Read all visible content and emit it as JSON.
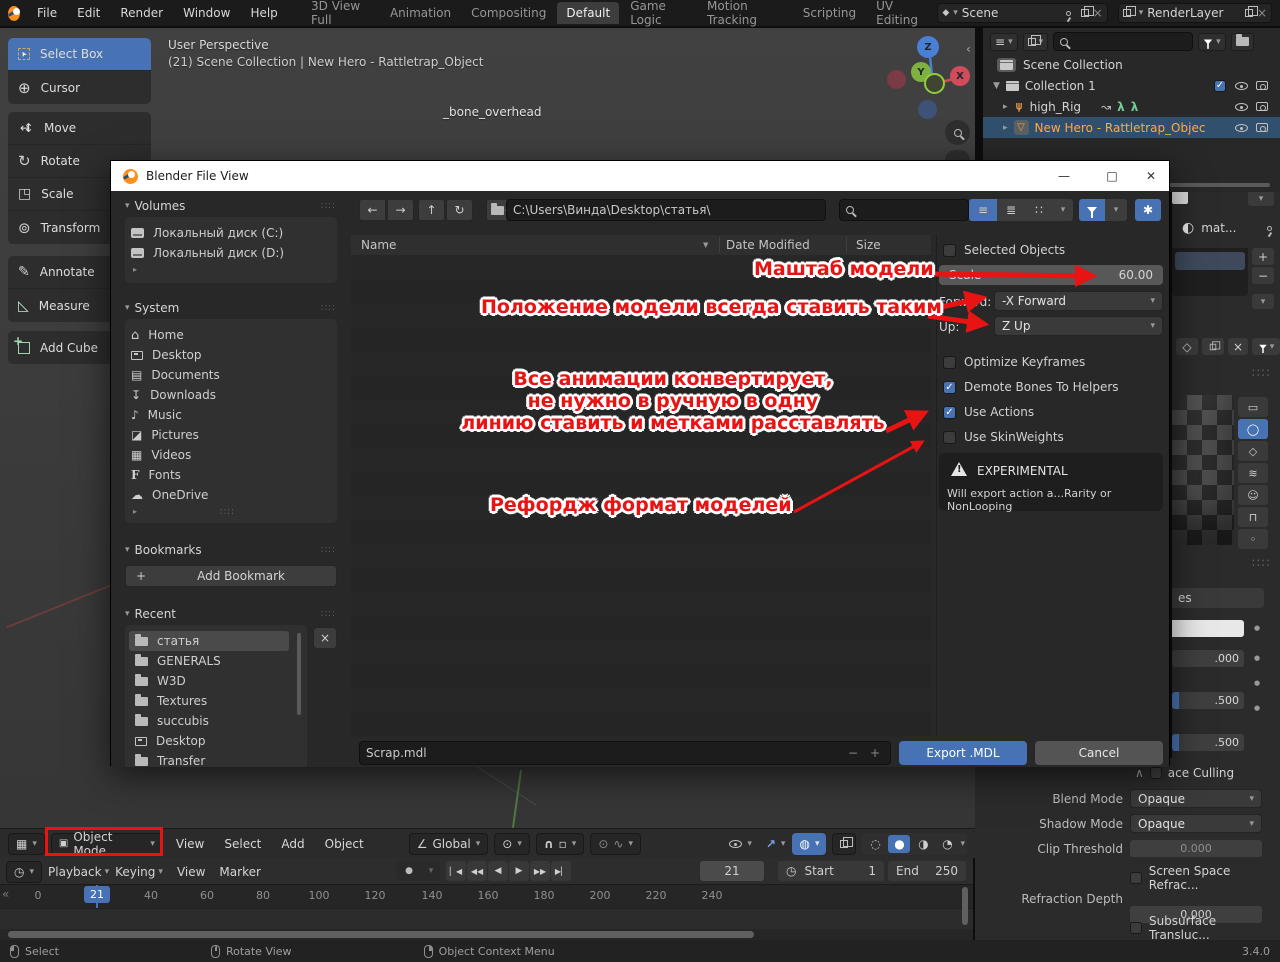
{
  "topbar": {
    "menus": [
      "File",
      "Edit",
      "Render",
      "Window",
      "Help"
    ],
    "workspaces": [
      "3D View Full",
      "Animation",
      "Compositing",
      "Default",
      "Game Logic",
      "Motion Tracking",
      "Scripting",
      "UV Editing"
    ],
    "active_workspace": "Default",
    "scene_label": "Scene",
    "render_layer_label": "RenderLayer"
  },
  "tools": {
    "items": [
      "Select Box",
      "Cursor",
      "Move",
      "Rotate",
      "Scale",
      "Transform",
      "Annotate",
      "Measure",
      "Add Cube"
    ],
    "active": "Select Box"
  },
  "viewport": {
    "view_label": "User Perspective",
    "context_label": "(21) Scene Collection | New Hero - Rattletrap_Object",
    "bone_label": "_bone_overhead",
    "axis_z": "Z",
    "axis_y": "Y",
    "axis_x": "X",
    "header": {
      "mode": "Object Mode",
      "menus": [
        "View",
        "Select",
        "Add",
        "Object"
      ],
      "orientation": "Global"
    }
  },
  "outliner": {
    "root": "Scene Collection",
    "collection": "Collection 1",
    "armature": "high_Rig",
    "active_object": "New Hero - Rattletrap_Objec"
  },
  "file_dialog": {
    "title": "Blender File View",
    "path": "C:\\Users\\Винда\\Desktop\\статья\\",
    "section_volumes": "Volumes",
    "section_system": "System",
    "section_bookmarks": "Bookmarks",
    "section_recent": "Recent",
    "volumes": [
      "Локальный диск (C:)",
      "Локальный диск (D:)"
    ],
    "system": [
      "Home",
      "Desktop",
      "Documents",
      "Downloads",
      "Music",
      "Pictures",
      "Videos",
      "Fonts",
      "OneDrive"
    ],
    "add_bookmark": "Add Bookmark",
    "recent": [
      "статья",
      "GENERALS",
      "W3D",
      "Textures",
      "succubis",
      "Desktop",
      "Transfer"
    ],
    "columns": [
      "Name",
      "Date Modified",
      "Size"
    ],
    "filename": "Scrap.mdl",
    "export_label": "Export .MDL",
    "cancel_label": "Cancel",
    "options": {
      "selected_objects": "Selected Objects",
      "scale_label": "Scale",
      "scale_value": "60.00",
      "forward_label": "Forward:",
      "forward_value": "-X Forward",
      "up_label": "Up:",
      "up_value": "Z Up",
      "optimize": "Optimize Keyframes",
      "demote": "Demote Bones To Helpers",
      "use_actions": "Use Actions",
      "use_skinweights": "Use SkinWeights",
      "experimental": "EXPERIMENTAL",
      "experimental_note": "Will export action a...Rarity or NonLooping"
    }
  },
  "annotations": {
    "scale_note": "Маштаб модели",
    "orientation_note": "Положение модели всегда ставить таким",
    "actions_note_line1": "Все анимации конвертирует,",
    "actions_note_line2": "не нужно в ручную в одну",
    "actions_note_line3": "линию ставить и метками расставлять",
    "reforge_note": "Рефордж формат моделей",
    "red": "#e81313"
  },
  "properties": {
    "material_name": "mat...",
    "use_nodes_partial": "es",
    "sliders": [
      ".000",
      ".500",
      ".500"
    ],
    "backface_partial": "ace Culling",
    "blend_mode_label": "Blend Mode",
    "blend_mode_value": "Opaque",
    "shadow_mode_label": "Shadow Mode",
    "shadow_mode_value": "Opaque",
    "clip_threshold_label": "Clip Threshold",
    "clip_threshold_value": "0.000",
    "ssr_label": "Screen Space Refrac...",
    "refraction_label": "Refraction Depth",
    "refraction_value": "0.000",
    "sss_label": "Subsurface Transluc..."
  },
  "timeline": {
    "menus": [
      "Playback",
      "Keying",
      "View",
      "Marker"
    ],
    "current_frame": "21",
    "start_label": "Start",
    "start_value": "1",
    "end_label": "End",
    "end_value": "250",
    "ticks": [
      "0",
      "40",
      "60",
      "80",
      "100",
      "120",
      "140",
      "160",
      "180",
      "200",
      "220",
      "240"
    ]
  },
  "statusbar": {
    "select": "Select",
    "rotate": "Rotate View",
    "context_menu": "Object Context Menu",
    "version": "3.4.0"
  }
}
